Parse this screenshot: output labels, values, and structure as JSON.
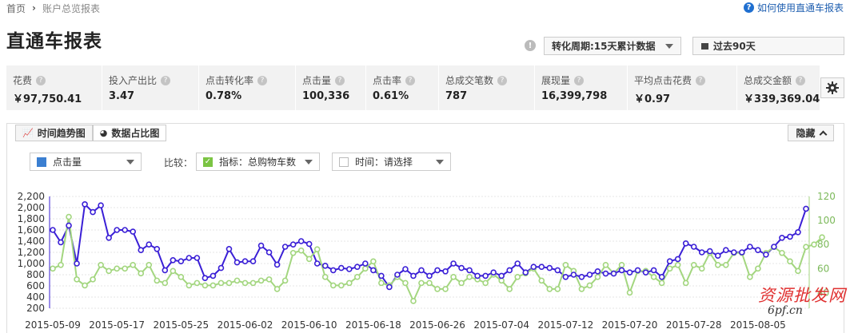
{
  "breadcrumb": {
    "home": "首页",
    "current": "账户总览报表"
  },
  "help_link": "如何使用直通车报表",
  "title": "直通车报表",
  "period_select": "转化周期:15天累计数据",
  "range_select": "过去90天",
  "metrics": [
    {
      "label": "花费",
      "value": "￥97,750.41"
    },
    {
      "label": "投入产出比",
      "value": "3.47"
    },
    {
      "label": "点击转化率",
      "value": "0.78%"
    },
    {
      "label": "点击量",
      "value": "100,336"
    },
    {
      "label": "点击率",
      "value": "0.61%"
    },
    {
      "label": "总成交笔数",
      "value": "787"
    },
    {
      "label": "展现量",
      "value": "16,399,798"
    },
    {
      "label": "平均点击花费",
      "value": "￥0.97"
    },
    {
      "label": "总成交金额",
      "value": "￥339,369.04"
    }
  ],
  "tabs": {
    "trend": "时间趋势图",
    "share": "数据占比图"
  },
  "hide_button": "隐藏",
  "controls": {
    "metric_select": "点击量",
    "compare_label": "比较：",
    "indicator_select": "指标：总购物车数",
    "time_select": "时间：请选择"
  },
  "watermark": {
    "main": "资源批发网",
    "sub": "6pf.cn"
  },
  "colors": {
    "primary": "#3a1fd6",
    "secondary": "#a3d67f",
    "metric_square": "#3b7fd1",
    "check": "#7bc443"
  },
  "chart_data": {
    "type": "line",
    "x_ticks": [
      "2015-05-09",
      "2015-05-17",
      "2015-05-25",
      "2015-06-02",
      "2015-06-10",
      "2015-06-18",
      "2015-06-26",
      "2015-07-04",
      "2015-07-12",
      "2015-07-20",
      "2015-07-28",
      "2015-08-05"
    ],
    "y_left": {
      "ticks": [
        "200",
        "400",
        "600",
        "800",
        "1,000",
        "1,200",
        "1,400",
        "1,600",
        "1,800",
        "2,000",
        "2,200"
      ],
      "range": [
        200,
        2200
      ]
    },
    "y_right": {
      "ticks": [
        "40",
        "60",
        "80",
        "100",
        "120"
      ],
      "range": [
        27,
        120
      ]
    },
    "series": [
      {
        "name": "点击量",
        "axis": "left",
        "color": "#3a1fd6",
        "values": [
          1600,
          1380,
          1680,
          1000,
          2060,
          1920,
          2040,
          1460,
          1600,
          1600,
          1570,
          1240,
          1340,
          1260,
          880,
          1060,
          1040,
          1100,
          1100,
          740,
          780,
          920,
          1260,
          1020,
          1040,
          1040,
          1320,
          1200,
          980,
          1300,
          1340,
          1400,
          1350,
          1000,
          960,
          880,
          920,
          900,
          940,
          1000,
          880,
          780,
          580,
          800,
          900,
          780,
          880,
          780,
          880,
          860,
          1000,
          920,
          880,
          780,
          780,
          840,
          780,
          880,
          1000,
          840,
          940,
          940,
          920,
          880,
          760,
          800,
          760,
          800,
          860,
          820,
          820,
          880,
          840,
          880,
          840,
          880,
          760,
          1040,
          1080,
          1360,
          1300,
          1200,
          1220,
          1140,
          1240,
          1200,
          1200,
          1300,
          1240,
          1160,
          1300,
          1460,
          1480,
          1560,
          1980
        ]
      },
      {
        "name": "总购物车数",
        "axis": "right",
        "color": "#a3d67f",
        "values": [
          60,
          63,
          103,
          51,
          46,
          51,
          63,
          58,
          60,
          60,
          63,
          56,
          63,
          50,
          48,
          58,
          53,
          46,
          48,
          46,
          46,
          48,
          48,
          50,
          48,
          48,
          50,
          51,
          43,
          50,
          73,
          75,
          68,
          76,
          53,
          46,
          46,
          48,
          53,
          60,
          66,
          48,
          46,
          53,
          48,
          33,
          48,
          48,
          43,
          43,
          53,
          48,
          53,
          51,
          48,
          55,
          50,
          43,
          53,
          56,
          60,
          50,
          43,
          43,
          63,
          58,
          43,
          46,
          53,
          63,
          56,
          63,
          40,
          58,
          58,
          53,
          48,
          60,
          63,
          48,
          63,
          60,
          73,
          63,
          63,
          73,
          73,
          53,
          60,
          73,
          78,
          73,
          66,
          58,
          78,
          80,
          86
        ]
      }
    ]
  }
}
